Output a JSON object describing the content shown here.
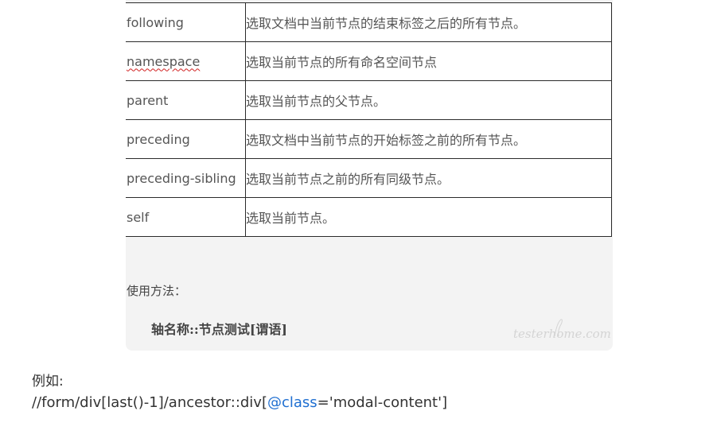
{
  "axis_table": {
    "rows": [
      {
        "axis": "following",
        "description": "选取文档中当前节点的结束标签之后的所有节点。"
      },
      {
        "axis": "namespace",
        "description": "选取当前节点的所有命名空间节点"
      },
      {
        "axis": "parent",
        "description": "选取当前节点的父节点。"
      },
      {
        "axis": "preceding",
        "description": "选取文档中当前节点的开始标签之前的所有节点。"
      },
      {
        "axis": "preceding-sibling",
        "description": "选取当前节点之前的所有同级节点。"
      },
      {
        "axis": "self",
        "description": "选取当前节点。"
      }
    ]
  },
  "usage": {
    "label": "使用方法：",
    "syntax": "轴名称::节点测试[谓语]"
  },
  "watermark": {
    "text": "testerhome.com"
  },
  "example": {
    "label": "例如:",
    "code_prefix": "//form/div[last()-1]/ancestor::div[",
    "code_mention": "@class",
    "code_suffix": "='modal-content']"
  }
}
